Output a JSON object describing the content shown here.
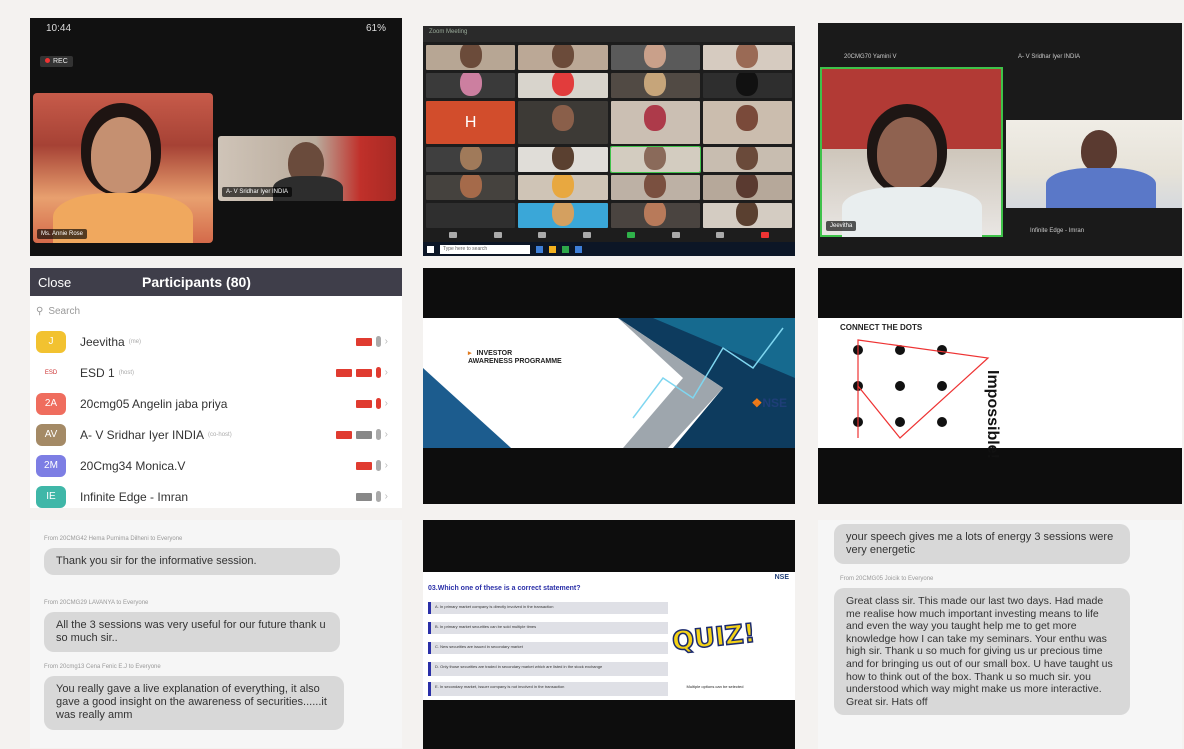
{
  "tile1": {
    "time": "10:44",
    "battery": "61%",
    "rec": "REC",
    "speaker": "Ms. Annie Rose",
    "guest": "A- V Sridhar Iyer INDIA"
  },
  "tile2": {
    "title": "Zoom Meeting",
    "h_initial": "H",
    "taskbar_search": "Type here to search",
    "cells": [
      "",
      "",
      "",
      "",
      "",
      "",
      "",
      "",
      "",
      "",
      "",
      "",
      "",
      "",
      "",
      "",
      "",
      "",
      "",
      "",
      "",
      "",
      "",
      ""
    ]
  },
  "tile3": {
    "left_top": "20CMG70 Yamini V",
    "right_top": "A- V Sridhar Iyer INDIA",
    "left_bottom": "Jeevitha",
    "right_bottom": "Infinite Edge - Imran"
  },
  "participants": {
    "close": "Close",
    "title": "Participants (80)",
    "search_placeholder": "Search",
    "rows": [
      {
        "avatar": "J",
        "color": "#f2c230",
        "name": "Jeevitha",
        "role": "(me)"
      },
      {
        "avatar": "ESD",
        "color": "#ffffff",
        "name": "ESD 1",
        "role": "(host)"
      },
      {
        "avatar": "2A",
        "color": "#ef6d5e",
        "name": "20cmg05 Angelin jaba priya",
        "role": ""
      },
      {
        "avatar": "AV",
        "color": "#a48a66",
        "name": "A- V Sridhar Iyer INDIA",
        "role": "(co-host)"
      },
      {
        "avatar": "2M",
        "color": "#7d7ee4",
        "name": "20Cmg34 Monica.V",
        "role": ""
      },
      {
        "avatar": "IE",
        "color": "#3fb7a8",
        "name": "Infinite Edge - Imran",
        "role": ""
      }
    ]
  },
  "slide_nse": {
    "line1": "INVESTOR",
    "line2": "AWARENESS PROGRAMME",
    "logo": "NSE"
  },
  "slide_dots": {
    "title": "CONNECT THE DOTS",
    "word": "Impossible!"
  },
  "chat1": {
    "messages": [
      {
        "meta": "From 20CMG42 Hema Purnima Dilheni to Everyone",
        "text": "Thank you sir for the informative session."
      },
      {
        "meta": "From 20CMG29 LAVANYA to Everyone",
        "text": "All the 3 sessions was very useful for our future thank u so much sir.."
      },
      {
        "meta": "From 20cmg13 Cena Fenic E.J to Everyone",
        "text": "You really gave a live explanation of everything, it also gave a good insight on the awareness of securities......it was really amm"
      }
    ]
  },
  "quiz": {
    "question": "03.Which one of these is a correct statement?",
    "options": [
      "A. In primary market company is directly involved in the transaction",
      "B. In primary market securities can be sold multiple times",
      "C. New securities are issued in secondary market",
      "D. Only those securities are traded in secondary market which are listed in the stock exchange",
      "E. In secondary market, issuer company is not involved in the transaction"
    ],
    "badge": "QUIZ!",
    "note": "Multiple options can be selected",
    "logo": "NSE"
  },
  "chat2": {
    "messages": [
      {
        "meta": "",
        "text": "your speech gives me a lots of energy  3 sessions were very energetic"
      },
      {
        "meta": "From 20CMG05 Joicik to Everyone",
        "text": "Great class sir. This made our last two days. Had made me realise how much important investing means to life and even the way you taught help me to get more knowledge how I can take my seminars. Your enthu was high sir. Thank u so much for giving us ur precious time and for bringing us out of our small box. U have taught us how to think out of the box. Thank u so much sir. you understood which way might make us more interactive. Great sir. Hats off"
      }
    ]
  }
}
